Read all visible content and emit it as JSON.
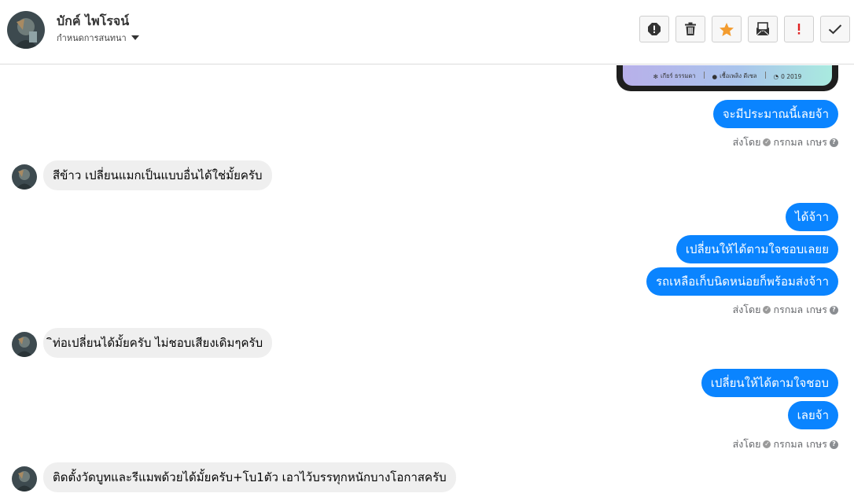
{
  "header": {
    "contact_name": "บักค์ ไพโรจน์",
    "subtitle": "กำหนดการสนทนา",
    "toolbar": [
      {
        "name": "report-icon",
        "color": "#333333"
      },
      {
        "name": "trash-icon",
        "color": "#333333"
      },
      {
        "name": "star-icon",
        "color": "#f39c2f"
      },
      {
        "name": "mail-icon",
        "color": "#333333"
      },
      {
        "name": "exclamation-icon",
        "color": "#e02020"
      },
      {
        "name": "check-icon",
        "color": "#333333"
      }
    ]
  },
  "shared_post": {
    "stats": [
      "เกียร์ ธรรมดา",
      "เชื้อเพลิง ดีเซล",
      "0 2019"
    ]
  },
  "messages": [
    {
      "dir": "out",
      "text": "จะมีประมาณนี้เลยจ้า"
    },
    {
      "dir": "meta",
      "prefix": "ส่งโดย",
      "sender": "กรกมล เกษร"
    },
    {
      "dir": "in",
      "text": "สีข้าว เปลี่ยนแมกเป็นแบบอื่นได้ใช่มั้ยครับ"
    },
    {
      "dir": "out",
      "text": "ได้จ้าา"
    },
    {
      "dir": "out",
      "text": "เปลี่ยนให้ได้ตามใจชอบเลยย"
    },
    {
      "dir": "out",
      "text": "รถเหลือเก็บนิดหน่อยก็พร้อมส่งจ้าา"
    },
    {
      "dir": "meta",
      "prefix": "ส่งโดย",
      "sender": "กรกมล เกษร"
    },
    {
      "dir": "in",
      "text": "ิท่อเปลี่ยนได้มั้ยครับ ไม่ชอบเสียงเดิมๆครับ"
    },
    {
      "dir": "out",
      "text": "เปลี่ยนให้ได้ตามใจชอบ"
    },
    {
      "dir": "out",
      "text": "เลยจ้า"
    },
    {
      "dir": "meta",
      "prefix": "ส่งโดย",
      "sender": "กรกมล เกษร"
    },
    {
      "dir": "in",
      "text": "ติดตั้งวัดบูทและรีแมพด้วยได้มั้ยครับ+โบ1ตัว  เอาไว้บรรทุกหนักบางโอกาสครับ"
    }
  ],
  "colors": {
    "outgoing_bubble": "#0a84ff",
    "incoming_bubble": "#efefef",
    "meta_text": "#65676b"
  }
}
